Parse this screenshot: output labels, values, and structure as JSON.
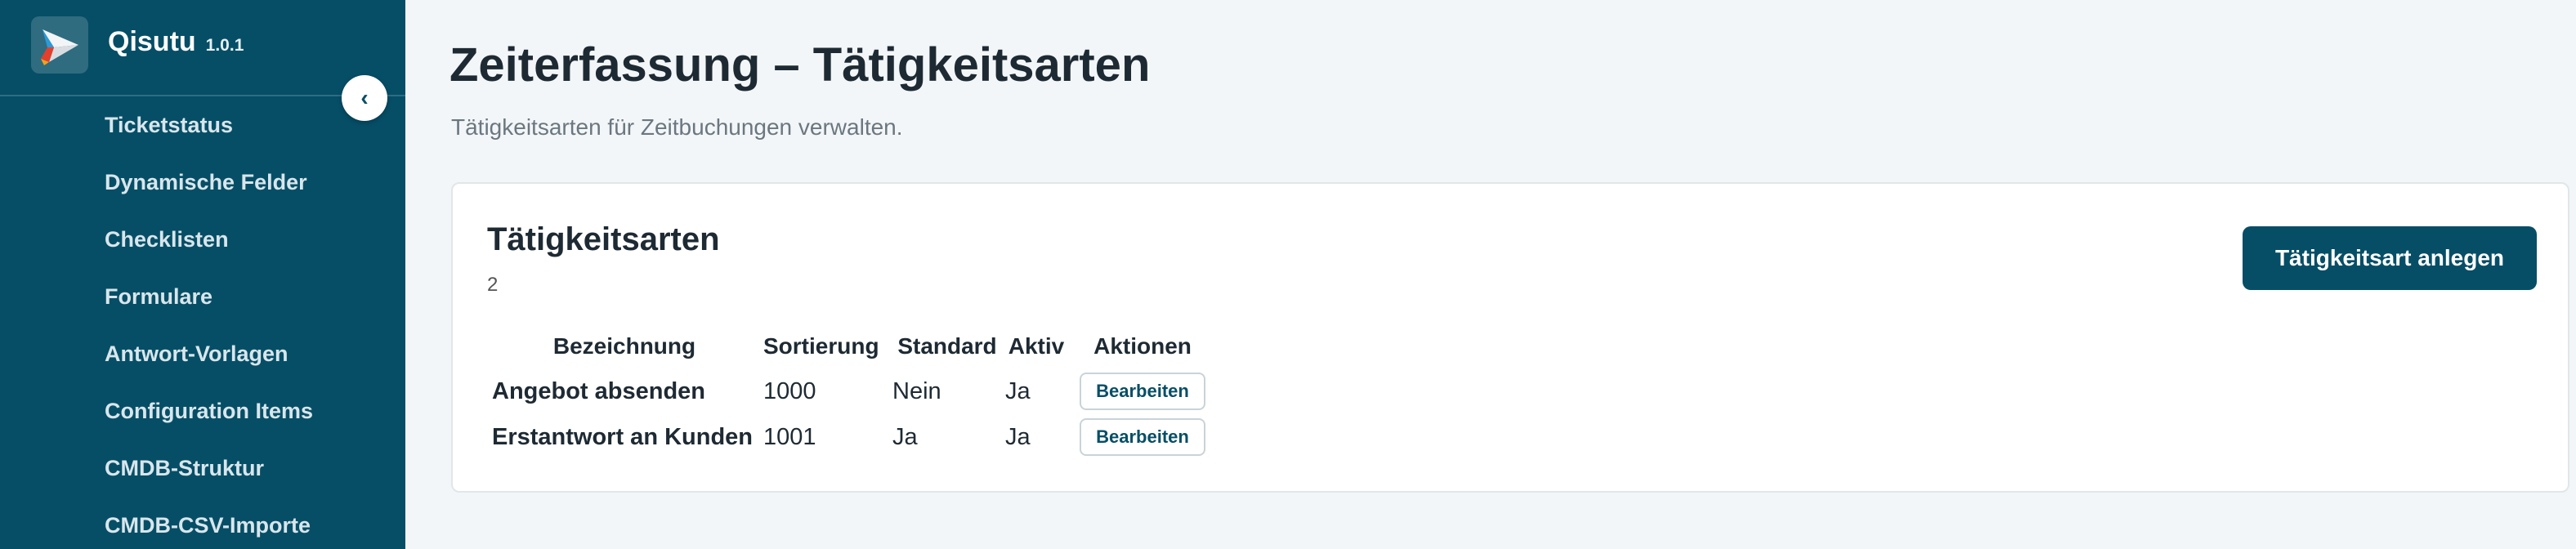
{
  "app": {
    "name": "Qisutu",
    "version": "1.0.1",
    "logo_icon": "paper-plane-logo-icon",
    "accent": "#064e66"
  },
  "sidebar": {
    "collapse_glyph": "‹",
    "items": [
      {
        "label": "Ticketstatus"
      },
      {
        "label": "Dynamische Felder"
      },
      {
        "label": "Checklisten"
      },
      {
        "label": "Formulare"
      },
      {
        "label": "Antwort-Vorlagen"
      },
      {
        "label": "Configuration Items"
      },
      {
        "label": "CMDB-Struktur"
      },
      {
        "label": "CMDB-CSV-Importe"
      }
    ]
  },
  "page": {
    "title": "Zeiterfassung – Tätigkeitsarten",
    "subtitle": "Tätigkeitsarten für Zeitbuchungen verwalten."
  },
  "card": {
    "title": "Tätigkeitsarten",
    "count": "2",
    "create_button": "Tätigkeitsart anlegen",
    "table": {
      "headers": {
        "name": "Bezeichnung",
        "sort": "Sortierung",
        "standard": "Standard",
        "active": "Aktiv",
        "actions": "Aktionen"
      },
      "rows": [
        {
          "name": "Angebot absenden",
          "sort": "1000",
          "standard": "Nein",
          "active": "Ja",
          "action": "Bearbeiten"
        },
        {
          "name": "Erstantwort an Kunden",
          "sort": "1001",
          "standard": "Ja",
          "active": "Ja",
          "action": "Bearbeiten"
        }
      ]
    }
  }
}
